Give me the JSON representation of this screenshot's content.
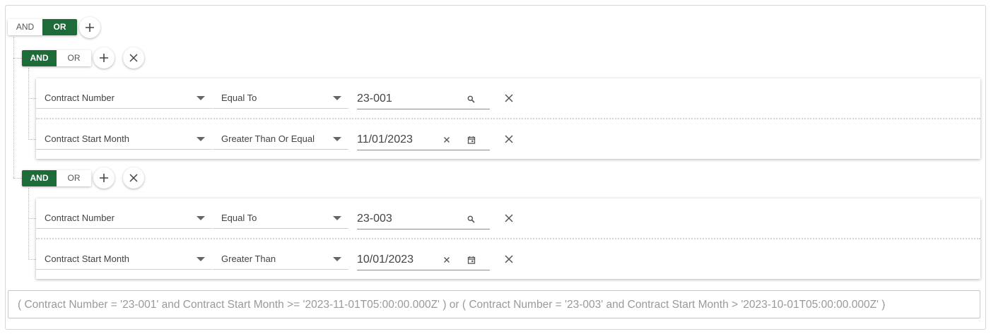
{
  "root": {
    "toggle": {
      "and": "AND",
      "or": "OR",
      "active": "or"
    }
  },
  "groups": [
    {
      "toggle": {
        "and": "AND",
        "or": "OR",
        "active": "and"
      },
      "rules": [
        {
          "field": "Contract Number",
          "operator": "Equal To",
          "value": "23-001",
          "value_type": "text"
        },
        {
          "field": "Contract Start Month",
          "operator": "Greater Than Or Equal",
          "value": "11/01/2023",
          "value_type": "date"
        }
      ]
    },
    {
      "toggle": {
        "and": "AND",
        "or": "OR",
        "active": "and"
      },
      "rules": [
        {
          "field": "Contract Number",
          "operator": "Equal To",
          "value": "23-003",
          "value_type": "text"
        },
        {
          "field": "Contract Start Month",
          "operator": "Greater Than",
          "value": "10/01/2023",
          "value_type": "date"
        }
      ]
    }
  ],
  "summary": "( Contract Number = '23-001' and Contract Start Month >= '2023-11-01T05:00:00.000Z' ) or ( Contract Number = '23-003' and Contract Start Month > '2023-10-01T05:00:00.000Z' )",
  "icons": {
    "add": "plus-icon",
    "remove": "close-icon",
    "search": "search-icon",
    "clear": "clear-icon",
    "calendar": "calendar-icon",
    "dropdown": "caret-down-icon"
  },
  "colors": {
    "accent": "#1e6b3a"
  }
}
